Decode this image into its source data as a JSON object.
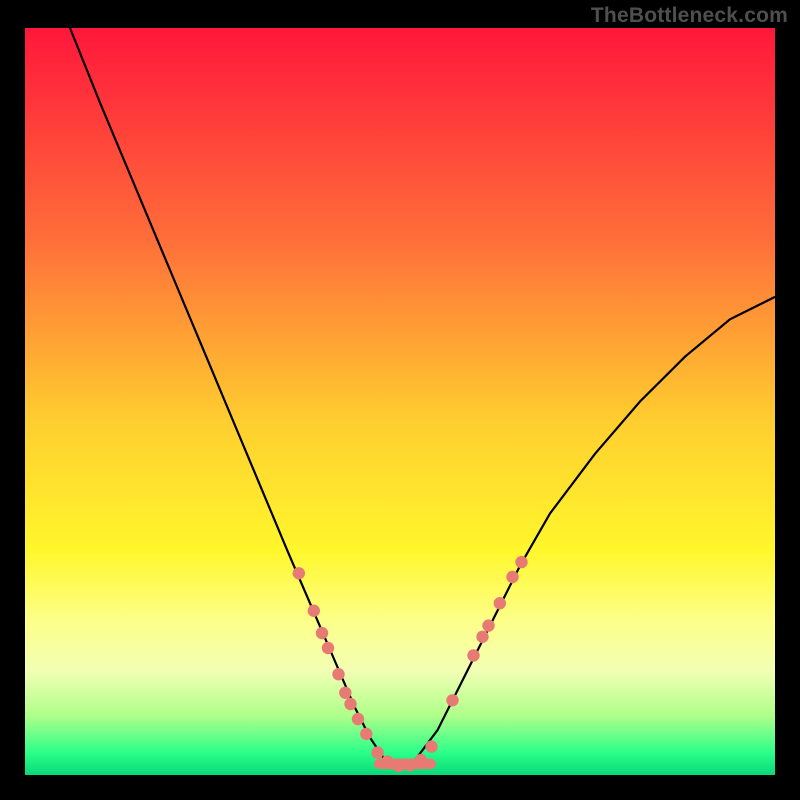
{
  "watermark": "TheBottleneck.com",
  "chart_data": {
    "type": "line",
    "title": "",
    "xlabel": "",
    "ylabel": "",
    "xlim": [
      0,
      100
    ],
    "ylim": [
      0,
      100
    ],
    "note": "Axes are unlabeled; values are relative percentages read off the plot area.",
    "background_gradient": {
      "stops": [
        {
          "offset": 0.0,
          "color": "#ff173b"
        },
        {
          "offset": 0.28,
          "color": "#ff6d3a"
        },
        {
          "offset": 0.53,
          "color": "#ffcf2f"
        },
        {
          "offset": 0.7,
          "color": "#fff72c"
        },
        {
          "offset": 0.79,
          "color": "#fdff86"
        },
        {
          "offset": 0.86,
          "color": "#f2ffb4"
        },
        {
          "offset": 0.92,
          "color": "#b0ff8a"
        },
        {
          "offset": 0.97,
          "color": "#2bff89"
        },
        {
          "offset": 1.0,
          "color": "#09d879"
        }
      ]
    },
    "series": [
      {
        "name": "bottleneck-curve",
        "x": [
          6,
          10,
          15,
          20,
          25,
          30,
          35,
          38,
          41,
          44,
          46,
          48,
          50,
          52,
          55,
          58,
          62,
          66,
          70,
          76,
          82,
          88,
          94,
          100
        ],
        "y": [
          100,
          90,
          78,
          66,
          54,
          42,
          30,
          23,
          16,
          9,
          5,
          2,
          1,
          2,
          6,
          12,
          20,
          28,
          35,
          43,
          50,
          56,
          61,
          64
        ]
      }
    ],
    "markers": {
      "name": "highlighted-points",
      "color": "#e77b74",
      "points": [
        {
          "x": 36.5,
          "y": 27
        },
        {
          "x": 38.5,
          "y": 22
        },
        {
          "x": 39.6,
          "y": 19
        },
        {
          "x": 40.4,
          "y": 17
        },
        {
          "x": 41.8,
          "y": 13.5
        },
        {
          "x": 42.7,
          "y": 11
        },
        {
          "x": 43.4,
          "y": 9.5
        },
        {
          "x": 44.4,
          "y": 7.5
        },
        {
          "x": 45.5,
          "y": 5.5
        },
        {
          "x": 47.0,
          "y": 3.0
        },
        {
          "x": 48.3,
          "y": 1.8
        },
        {
          "x": 49.8,
          "y": 1.2
        },
        {
          "x": 51.3,
          "y": 1.3
        },
        {
          "x": 52.8,
          "y": 2.0
        },
        {
          "x": 54.2,
          "y": 3.8
        },
        {
          "x": 57.0,
          "y": 10
        },
        {
          "x": 59.8,
          "y": 16
        },
        {
          "x": 61.0,
          "y": 18.5
        },
        {
          "x": 61.8,
          "y": 20
        },
        {
          "x": 63.3,
          "y": 23
        },
        {
          "x": 65.0,
          "y": 26.5
        },
        {
          "x": 66.2,
          "y": 28.5
        }
      ]
    },
    "bottom_trough": {
      "name": "trough-fill",
      "color": "#e77b74",
      "x_start": 46.5,
      "x_end": 54.8,
      "y": 1.5,
      "thickness_pct": 1.4
    }
  }
}
